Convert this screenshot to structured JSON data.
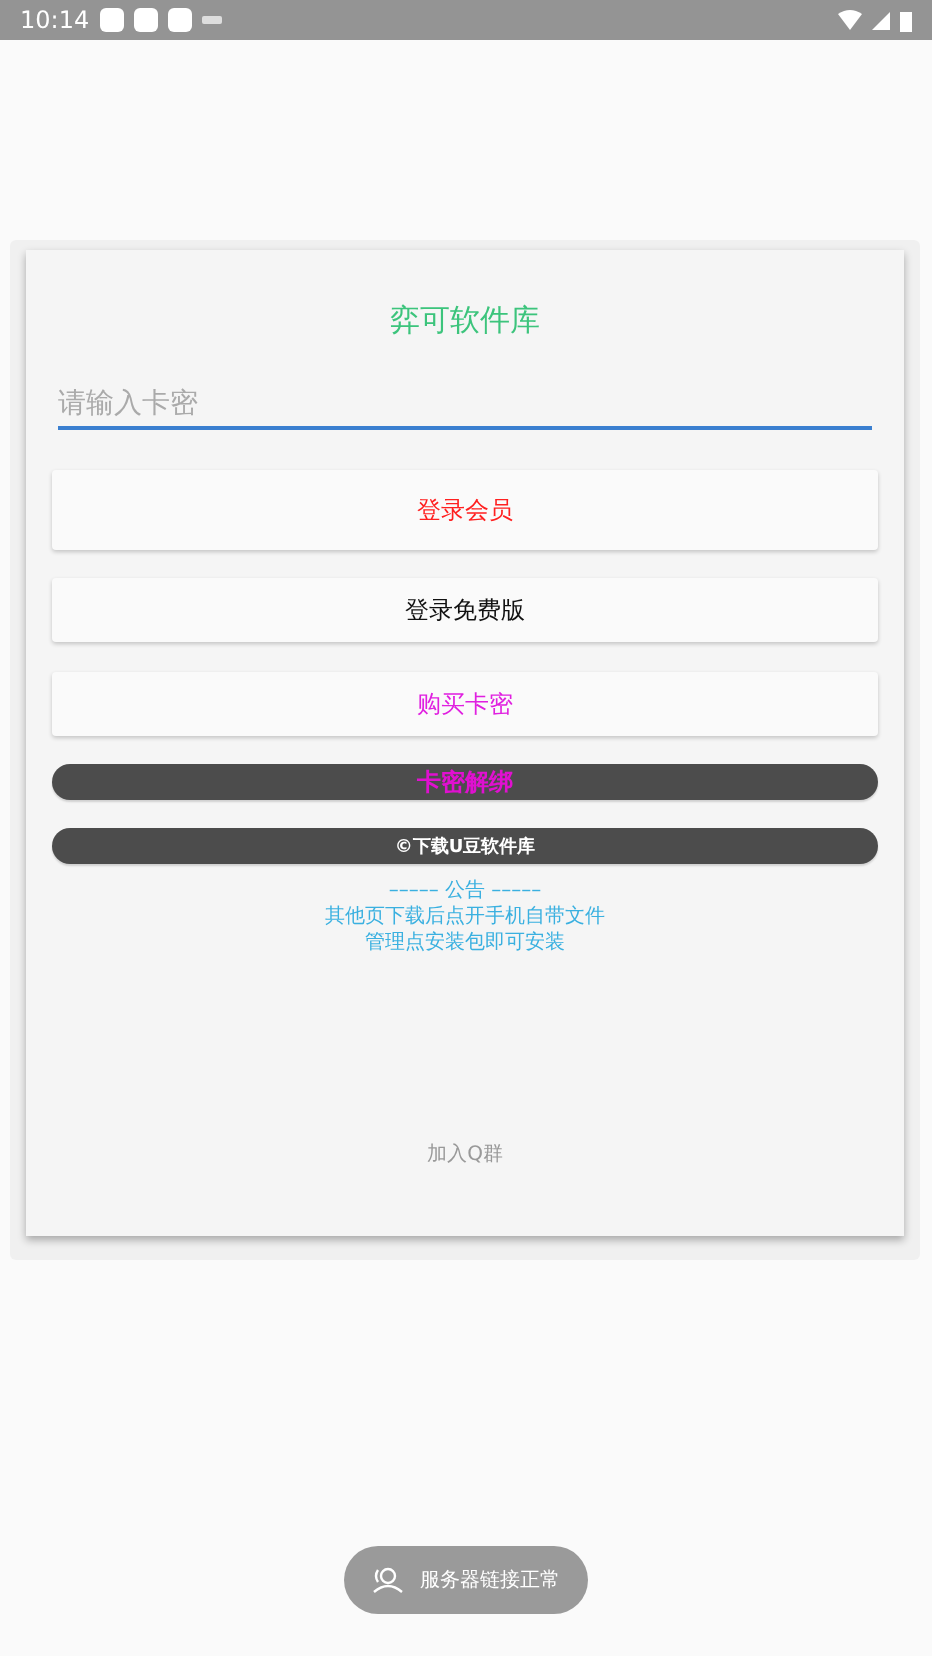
{
  "status_bar": {
    "time": "10:14"
  },
  "title": "弈可软件库",
  "card_input": {
    "placeholder": "请输入卡密"
  },
  "buttons": [
    {
      "label": "登录会员",
      "kind": "flat",
      "color": "#ff2020"
    },
    {
      "label": "登录免费版",
      "kind": "flat",
      "color": "#111111"
    },
    {
      "label": "购买卡密",
      "kind": "flat",
      "color": "#e020e0"
    },
    {
      "label": "卡密解绑",
      "kind": "pill",
      "color": "#e010d0"
    },
    {
      "label": "©下载U豆软件库",
      "kind": "pill",
      "color": "#ffffff"
    }
  ],
  "announcement": [
    "–––––  公告  –––––",
    "其他页下载后点开手机自带文件",
    "管理点安装包即可安装"
  ],
  "join_group": "加入Q群",
  "toast": {
    "text": "服务器链接正常"
  }
}
